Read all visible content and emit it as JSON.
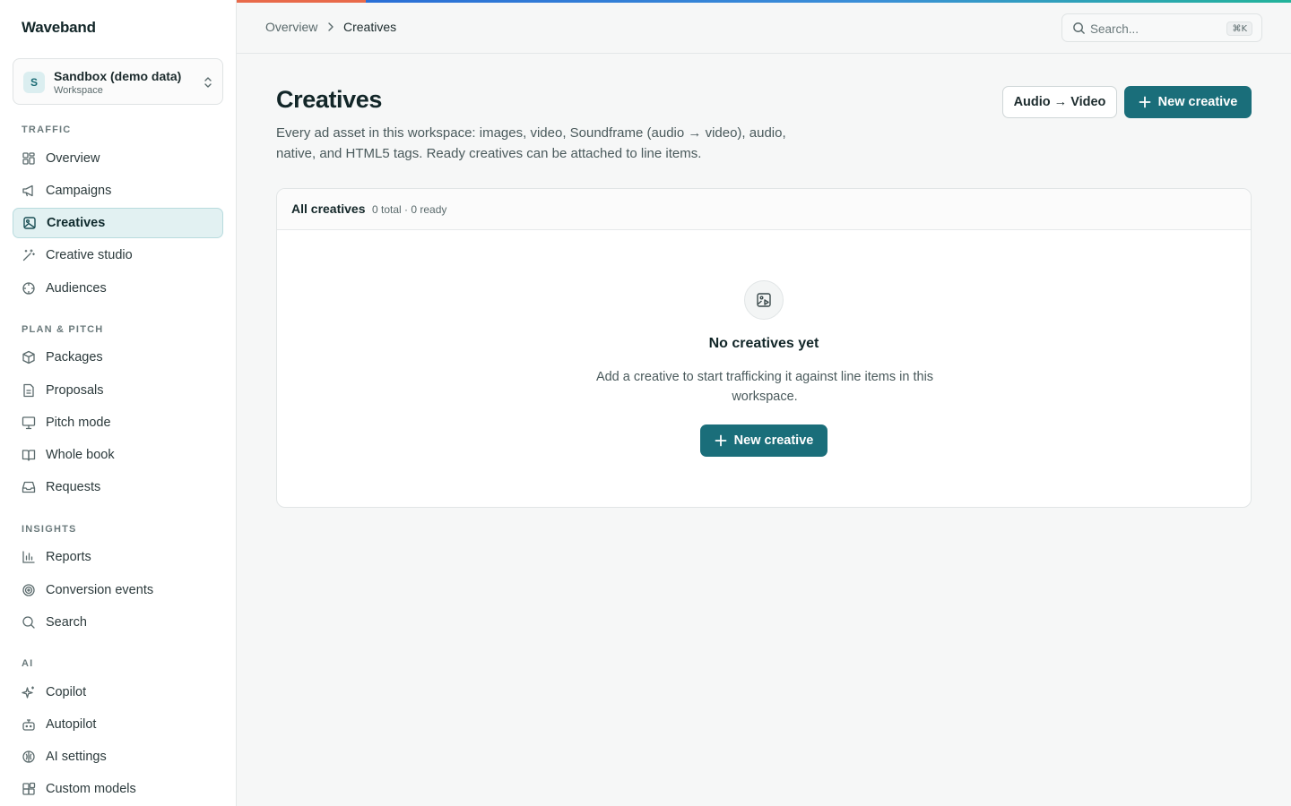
{
  "app": {
    "brand": "Waveband"
  },
  "workspace": {
    "initial": "S",
    "name": "Sandbox (demo data)",
    "subtitle": "Workspace"
  },
  "sidebar": {
    "sections": [
      {
        "label": "TRAFFIC",
        "items": [
          {
            "label": "Overview",
            "icon": "grid-icon"
          },
          {
            "label": "Campaigns",
            "icon": "megaphone-icon"
          },
          {
            "label": "Creatives",
            "icon": "image-icon",
            "active": true
          },
          {
            "label": "Creative studio",
            "icon": "wand-icon"
          },
          {
            "label": "Audiences",
            "icon": "crosshair-icon"
          }
        ]
      },
      {
        "label": "PLAN & PITCH",
        "items": [
          {
            "label": "Packages",
            "icon": "package-icon"
          },
          {
            "label": "Proposals",
            "icon": "document-icon"
          },
          {
            "label": "Pitch mode",
            "icon": "presentation-icon"
          },
          {
            "label": "Whole book",
            "icon": "book-icon"
          },
          {
            "label": "Requests",
            "icon": "inbox-icon"
          }
        ]
      },
      {
        "label": "INSIGHTS",
        "items": [
          {
            "label": "Reports",
            "icon": "bar-chart-icon"
          },
          {
            "label": "Conversion events",
            "icon": "target-icon"
          },
          {
            "label": "Search",
            "icon": "search-icon"
          }
        ]
      },
      {
        "label": "AI",
        "items": [
          {
            "label": "Copilot",
            "icon": "sparkles-icon"
          },
          {
            "label": "Autopilot",
            "icon": "bot-icon"
          },
          {
            "label": "AI settings",
            "icon": "brain-icon"
          },
          {
            "label": "Custom models",
            "icon": "blocks-icon"
          }
        ]
      }
    ]
  },
  "breadcrumb": {
    "parent": "Overview",
    "current": "Creatives"
  },
  "search": {
    "placeholder": "Search...",
    "shortcut": "⌘K"
  },
  "page": {
    "title": "Creatives",
    "description": "Every ad asset in this workspace: images, video, Soundframe (audio → video), audio, native, and HTML5 tags. Ready creatives can be attached to line items.",
    "audio_video_label": "Audio → Video",
    "new_creative_label": "New creative"
  },
  "card": {
    "title": "All creatives",
    "count": "0 total · 0 ready",
    "empty_title": "No creatives yet",
    "empty_description": "Add a creative to start trafficking it against line items in this workspace.",
    "empty_button_label": "New creative"
  },
  "colors": {
    "primary": "#1a6e7a",
    "active_bg": "#e2f1f2",
    "accent_orange": "#e86a4a",
    "accent_blue": "#2a6fd6",
    "accent_teal": "#22b39a"
  }
}
